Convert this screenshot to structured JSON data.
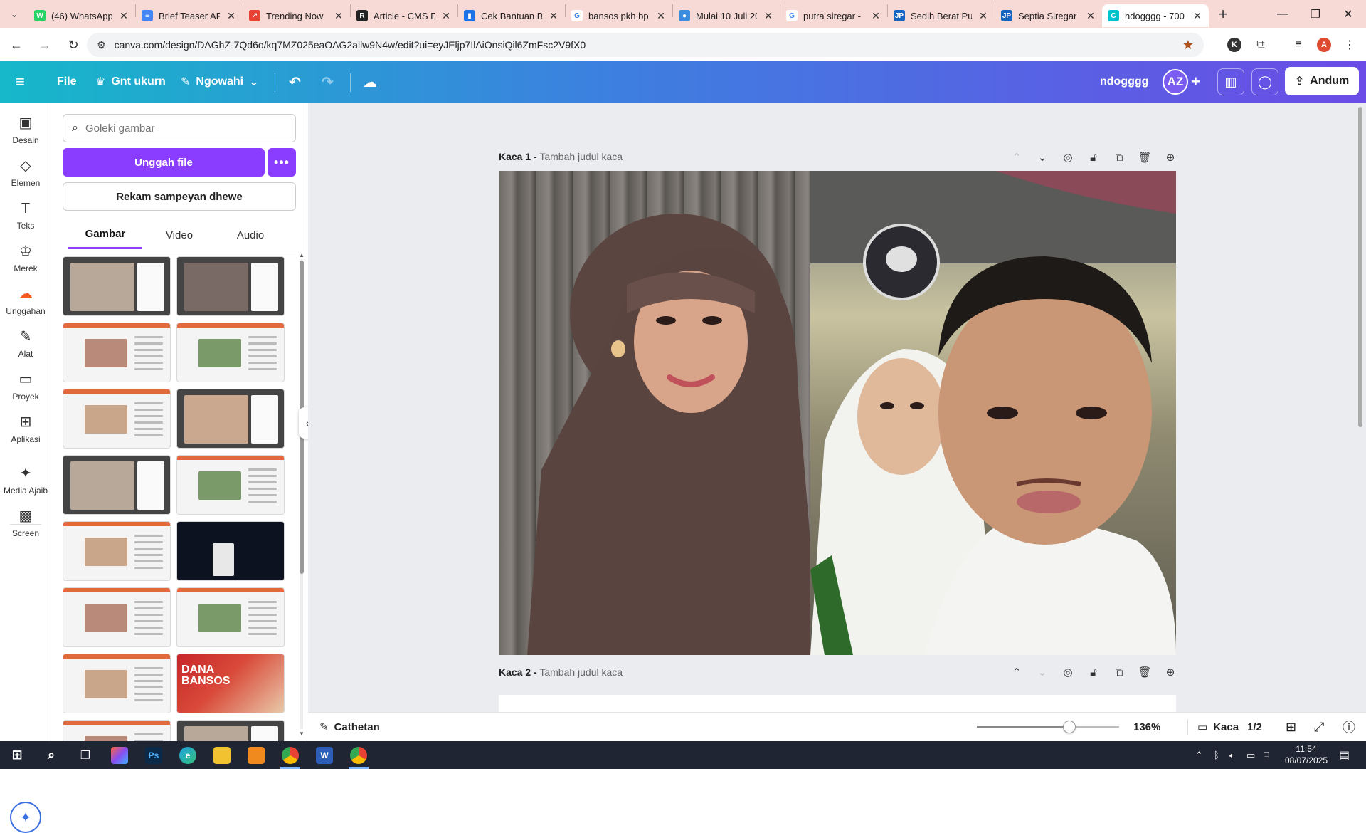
{
  "browser": {
    "tabs": [
      {
        "title": "(46) WhatsApp",
        "icon": "whatsapp-icon",
        "color": "#25d366",
        "glyph": "W"
      },
      {
        "title": "Brief Teaser AP",
        "icon": "docs-icon",
        "color": "#4285f4",
        "glyph": "≡"
      },
      {
        "title": "Trending Now",
        "icon": "trends-icon",
        "color": "#e94235",
        "glyph": "↗"
      },
      {
        "title": "Article - CMS E",
        "icon": "cms-icon",
        "color": "#222222",
        "glyph": "R"
      },
      {
        "title": "Cek Bantuan B",
        "icon": "bookmark-icon",
        "color": "#1a73e8",
        "glyph": "▮"
      },
      {
        "title": "bansos pkh bp",
        "icon": "google-icon",
        "color": "#ffffff",
        "glyph": "G"
      },
      {
        "title": "Mulai 10 Juli 20",
        "icon": "news-icon",
        "color": "#3a8dde",
        "glyph": "●"
      },
      {
        "title": "putra siregar -",
        "icon": "google-icon",
        "color": "#ffffff",
        "glyph": "G"
      },
      {
        "title": "Sedih Berat Pu",
        "icon": "jp-icon",
        "color": "#1565c0",
        "glyph": "JP"
      },
      {
        "title": "Septia Siregar",
        "icon": "jp-icon",
        "color": "#1565c0",
        "glyph": "JP"
      },
      {
        "title": "ndogggg - 700",
        "icon": "canva-icon",
        "color": "#00c4cc",
        "glyph": "C"
      }
    ],
    "url": "canva.com/design/DAGhZ-7Qd6o/kq7MZ025eaOAG2allw9N4w/edit?ui=eyJEljp7IlAiOnsiQil6ZmFsc2V9fX0"
  },
  "canva": {
    "header": {
      "file": "File",
      "resize": "Gnt ukurn",
      "edit": "Ngowahi",
      "design_name": "ndogggg",
      "avatar": "AZ",
      "share": "Andum"
    },
    "rail": [
      {
        "label": "Desain",
        "icon": "design-icon",
        "glyph": "▣"
      },
      {
        "label": "Elemen",
        "icon": "elements-icon",
        "glyph": "◇"
      },
      {
        "label": "Teks",
        "icon": "text-icon",
        "glyph": "T"
      },
      {
        "label": "Merek",
        "icon": "brand-icon",
        "glyph": "♔"
      },
      {
        "label": "Unggahan",
        "icon": "uploads-icon",
        "glyph": "☁"
      },
      {
        "label": "Alat",
        "icon": "draw-icon",
        "glyph": "✎"
      },
      {
        "label": "Proyek",
        "icon": "projects-icon",
        "glyph": "▭"
      },
      {
        "label": "Aplikasi",
        "icon": "apps-icon",
        "glyph": "⊞"
      },
      {
        "label": "Media Ajaib",
        "icon": "magic-media-icon",
        "glyph": "✦"
      },
      {
        "label": "Screen",
        "icon": "screen-icon",
        "glyph": "▩"
      }
    ],
    "panel": {
      "search_placeholder": "Goleki gambar",
      "upload": "Unggah file",
      "record": "Rekam sampeyan dhewe",
      "tabs": [
        "Gambar",
        "Video",
        "Audio"
      ]
    },
    "pages": [
      {
        "label": "Kaca 1 -",
        "subtitle": "Tambah judul kaca"
      },
      {
        "label": "Kaca 2 -",
        "subtitle": "Tambah judul kaca"
      }
    ],
    "bottom": {
      "notes": "Cathetan",
      "zoom": "136%",
      "zoom_fraction": 0.65,
      "pages": "Kaca",
      "page_count": "1/2"
    }
  },
  "taskbar": {
    "time": "11:54",
    "date": "08/07/2025"
  }
}
